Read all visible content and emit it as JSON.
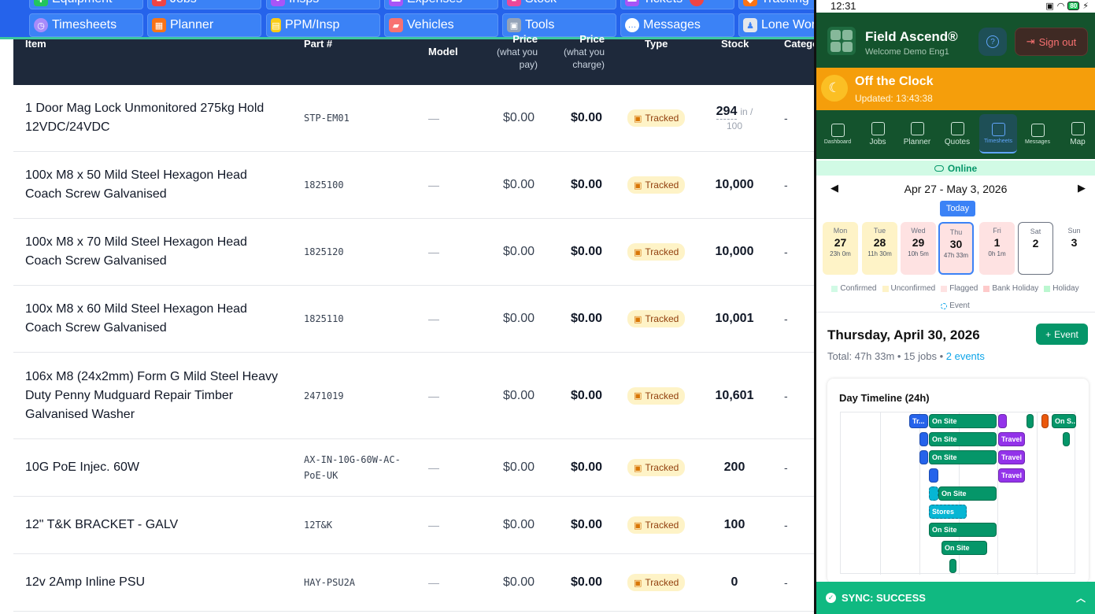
{
  "left_app": {
    "nav_row1": [
      {
        "label": "Equipment",
        "icon": "wrench-icon",
        "color": "#22c55e"
      },
      {
        "label": "Jobs",
        "icon": "briefcase-icon",
        "color": "#ef4444"
      },
      {
        "label": "Insps",
        "icon": "pin-icon",
        "color": "#a855f7"
      },
      {
        "label": "Expenses",
        "icon": "card-icon",
        "color": "#a855f7"
      },
      {
        "label": "Stock",
        "icon": "box-icon",
        "color": "#ec4899"
      },
      {
        "label": "Tickets",
        "icon": "ticket-icon",
        "color": "#a855f7"
      },
      {
        "label": "Tracking",
        "icon": "map-icon",
        "color": "#f97316"
      }
    ],
    "nav_row2": [
      {
        "label": "Timesheets",
        "icon": "clock-icon",
        "color": "#a78bfa"
      },
      {
        "label": "Planner",
        "icon": "calendar-icon",
        "color": "#f97316"
      },
      {
        "label": "PPM/Insp",
        "icon": "clipboard-icon",
        "color": "#facc15"
      },
      {
        "label": "Vehicles",
        "icon": "truck-icon",
        "color": "#f87171"
      },
      {
        "label": "Tools",
        "icon": "toolbox-icon",
        "color": "#94a3b8"
      },
      {
        "label": "Messages",
        "icon": "chat-icon",
        "color": "#ffffff"
      },
      {
        "label": "Lone Wor",
        "icon": "user-shield-icon",
        "color": "#e5e7eb"
      }
    ],
    "table": {
      "headers": {
        "item": "Item",
        "part": "Part #",
        "model": "Model",
        "cost": "Price",
        "cost_sub": "(what you pay)",
        "sell": "Price",
        "sell_sub": "(what you charge)",
        "type": "Type",
        "stock": "Stock",
        "category": "Catego"
      },
      "rows": [
        {
          "item": "1 Door Mag Lock Unmonitored 275kg Hold 12VDC/24VDC",
          "part": "STP-EM01",
          "model": "—",
          "cost": "$0.00",
          "sell": "$0.00",
          "type": "Tracked",
          "stock": "294",
          "stock_in": "in /",
          "stock_of": "100",
          "category": "-"
        },
        {
          "item": "100x M8 x 50 Mild Steel Hexagon Head Coach Screw Galvanised",
          "part": "1825100",
          "model": "—",
          "cost": "$0.00",
          "sell": "$0.00",
          "type": "Tracked",
          "stock": "10,000",
          "category": "-"
        },
        {
          "item": "100x M8 x 70 Mild Steel Hexagon Head Coach Screw Galvanised",
          "part": "1825120",
          "model": "—",
          "cost": "$0.00",
          "sell": "$0.00",
          "type": "Tracked",
          "stock": "10,000",
          "category": "-"
        },
        {
          "item": "100x M8 x 60 Mild Steel Hexagon Head Coach Screw Galvanised",
          "part": "1825110",
          "model": "—",
          "cost": "$0.00",
          "sell": "$0.00",
          "type": "Tracked",
          "stock": "10,001",
          "category": "-"
        },
        {
          "item": "106x M8 (24x2mm) Form G Mild Steel Heavy Duty Penny Mudguard Repair Timber Galvanised Washer",
          "part": "2471019",
          "model": "—",
          "cost": "$0.00",
          "sell": "$0.00",
          "type": "Tracked",
          "stock": "10,601",
          "category": "-"
        },
        {
          "item": "10G PoE Injec. 60W",
          "part": "AX-IN-10G-60W-AC-PoE-UK",
          "model": "—",
          "cost": "$0.00",
          "sell": "$0.00",
          "type": "Tracked",
          "stock": "200",
          "category": "-"
        },
        {
          "item": "12\" T&K BRACKET - GALV",
          "part": "12T&K",
          "model": "—",
          "cost": "$0.00",
          "sell": "$0.00",
          "type": "Tracked",
          "stock": "100",
          "category": "-"
        },
        {
          "item": "12v 2Amp Inline PSU",
          "part": "HAY-PSU2A",
          "model": "—",
          "cost": "$0.00",
          "sell": "$0.00",
          "type": "Tracked",
          "stock": "0",
          "category": "-"
        }
      ]
    }
  },
  "phone": {
    "status_bar": {
      "time": "12:31",
      "battery": "80"
    },
    "app": {
      "name": "Field Ascend®",
      "welcome": "Welcome Demo Eng1",
      "sign_out": "Sign out",
      "help_icon": "?"
    },
    "clock": {
      "title": "Off the Clock",
      "updated": "Updated: 13:43:38"
    },
    "tabs": [
      {
        "label": "Dashboard",
        "icon": "dashboard-icon"
      },
      {
        "label": "Jobs",
        "icon": "briefcase-icon"
      },
      {
        "label": "Planner",
        "icon": "calendar-icon"
      },
      {
        "label": "Quotes",
        "icon": "document-icon"
      },
      {
        "label": "Timesheets",
        "icon": "clock-icon",
        "active": true
      },
      {
        "label": "Messages",
        "icon": "chat-icon"
      },
      {
        "label": "Map",
        "icon": "map-icon"
      }
    ],
    "online": "Online",
    "week": {
      "range": "Apr 27 - May 3, 2026",
      "today": "Today",
      "prev": "◀",
      "next": "▶"
    },
    "days": [
      {
        "name": "Mon",
        "num": "27",
        "hours": "23h 0m",
        "status": "confirmed"
      },
      {
        "name": "Tue",
        "num": "28",
        "hours": "11h 30m",
        "status": "confirmed"
      },
      {
        "name": "Wed",
        "num": "29",
        "hours": "10h 5m",
        "status": "flagged"
      },
      {
        "name": "Thu",
        "num": "30",
        "hours": "47h 33m",
        "status": "flagged-current"
      },
      {
        "name": "Fri",
        "num": "1",
        "hours": "0h 1m",
        "status": "flagged"
      },
      {
        "name": "Sat",
        "num": "2",
        "hours": "",
        "status": "outlined"
      },
      {
        "name": "Sun",
        "num": "3",
        "hours": "",
        "status": "none"
      }
    ],
    "legend": [
      {
        "label": "Confirmed",
        "color": "#d1fae5"
      },
      {
        "label": "Unconfirmed",
        "color": "#fef3c7"
      },
      {
        "label": "Flagged",
        "color": "#fee2e2"
      },
      {
        "label": "Bank Holiday",
        "color": "#fecaca"
      },
      {
        "label": "Holiday",
        "color": "#bbf7d0"
      },
      {
        "label": "Event",
        "color": "#0ea5e9"
      }
    ],
    "day_detail": {
      "title": "Thursday, April 30, 2026",
      "total_prefix": "Total: 47h 33m • 15 jobs • ",
      "events_link": "2 events",
      "event_button": "Event"
    },
    "timeline": {
      "title": "Day Timeline (24h)",
      "bars": [
        {
          "label": "Tr...",
          "color": "#2563eb"
        },
        {
          "label": "On Site",
          "color": "#059669"
        },
        {
          "label": "",
          "color": "#9333ea"
        },
        {
          "label": "",
          "color": "#059669"
        },
        {
          "label": "",
          "color": "#ea580c"
        },
        {
          "label": "On S...",
          "color": "#059669"
        },
        {
          "label": "",
          "color": "#2563eb"
        },
        {
          "label": "On Site",
          "color": "#059669"
        },
        {
          "label": "Travel",
          "color": "#9333ea"
        },
        {
          "label": "",
          "color": "#059669"
        },
        {
          "label": "",
          "color": "#2563eb"
        },
        {
          "label": "On Site",
          "color": "#059669"
        },
        {
          "label": "Travel",
          "color": "#9333ea"
        },
        {
          "label": "",
          "color": "#2563eb"
        },
        {
          "label": "Travel",
          "color": "#9333ea"
        },
        {
          "label": "",
          "color": "#06b6d4"
        },
        {
          "label": "On Site",
          "color": "#059669"
        },
        {
          "label": "Stores",
          "color": "#06b6d4"
        },
        {
          "label": "On Site",
          "color": "#059669"
        },
        {
          "label": "On Site",
          "color": "#059669"
        },
        {
          "label": "",
          "color": "#059669"
        }
      ]
    },
    "sync": {
      "label": "SYNC: SUCCESS"
    }
  }
}
